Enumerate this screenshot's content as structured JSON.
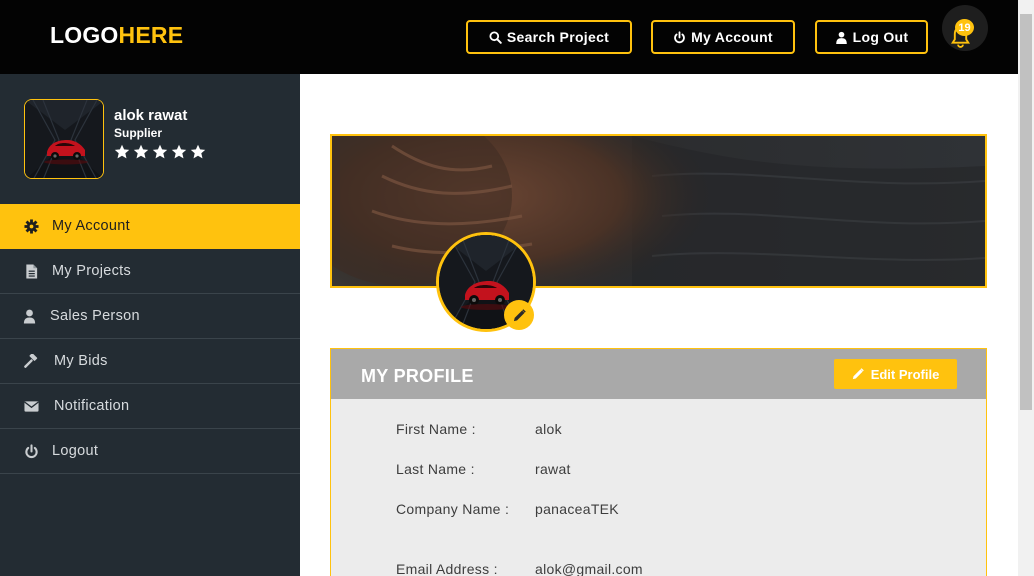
{
  "header": {
    "logo_part1": "LOGO",
    "logo_part2": "HERE",
    "search_label": "Search Project",
    "account_label": "My Account",
    "logout_label": "Log Out",
    "notification_count": "19"
  },
  "user": {
    "name": "alok rawat",
    "role": "Supplier",
    "rating_stars": 5
  },
  "sidebar": {
    "items": [
      {
        "label": "My Account",
        "icon": "gear-icon",
        "active": true
      },
      {
        "label": "My Projects",
        "icon": "file-icon",
        "active": false
      },
      {
        "label": "Sales Person",
        "icon": "user-icon",
        "active": false
      },
      {
        "label": "My Bids",
        "icon": "gavel-icon",
        "active": false
      },
      {
        "label": "Notification",
        "icon": "envelope-icon",
        "active": false
      },
      {
        "label": "Logout",
        "icon": "power-icon",
        "active": false
      }
    ]
  },
  "profile": {
    "title": "MY PROFILE",
    "edit_label": "Edit Profile",
    "fields": [
      {
        "label": "First Name :",
        "value": "alok"
      },
      {
        "label": "Last Name :",
        "value": "rawat"
      },
      {
        "label": "Company Name :",
        "value": "panaceaTEK"
      },
      {
        "label": "Email Address :",
        "value": "alok@gmail.com"
      }
    ]
  },
  "colors": {
    "accent": "#ffc20e",
    "header_bg": "#030303",
    "sidebar_bg": "#232c33",
    "card_head": "#a9a9a9",
    "card_body": "#ececec"
  }
}
